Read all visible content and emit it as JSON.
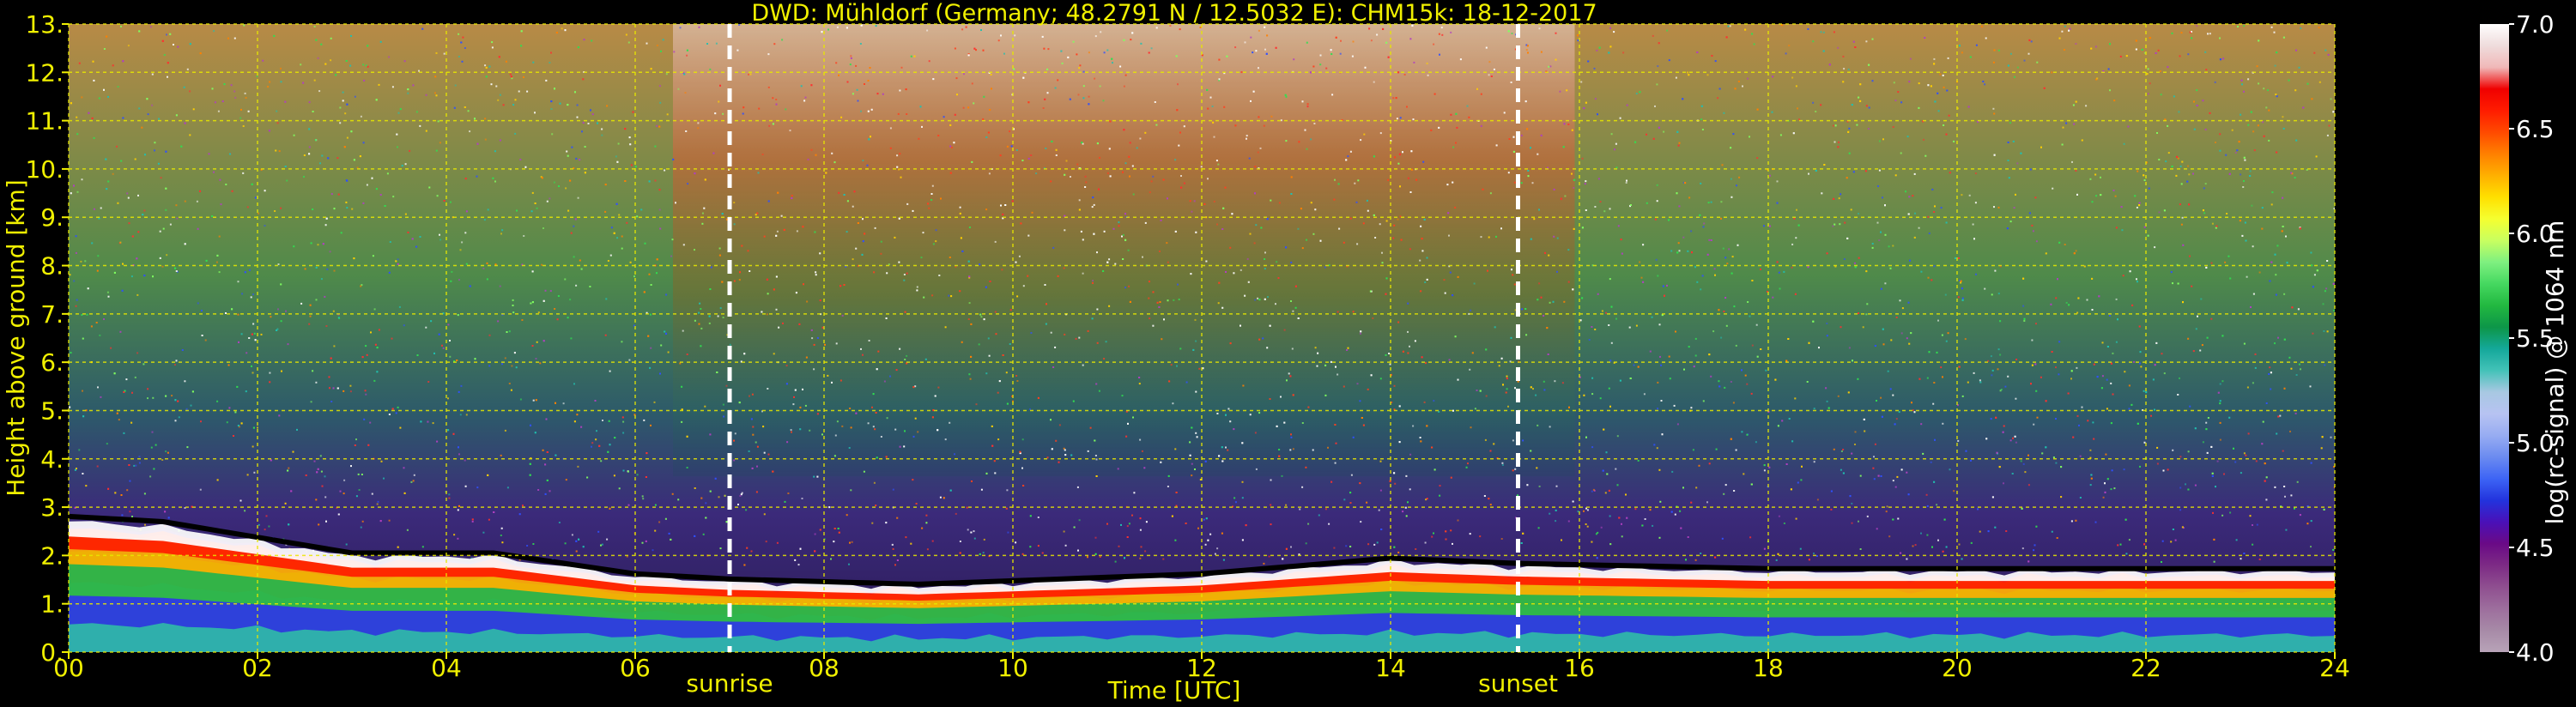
{
  "chart_data": {
    "type": "heatmap",
    "title": "DWD: Mühldorf (Germany; 48.2791 N / 12.5032 E):    CHM15k: 18-12-2017",
    "xlabel": "Time [UTC]",
    "ylabel": "Height above ground [km]",
    "xlim": [
      0,
      24
    ],
    "ylim": [
      0,
      13
    ],
    "x_ticks": [
      "00",
      "02",
      "04",
      "06",
      "08",
      "10",
      "12",
      "14",
      "16",
      "18",
      "20",
      "22",
      "24"
    ],
    "y_ticks": [
      "0.",
      "1.",
      "2.",
      "3.",
      "4.",
      "5.",
      "6.",
      "7.",
      "8.",
      "9.",
      "10.",
      "11.",
      "12.",
      "13."
    ],
    "grid": true,
    "markers": [
      {
        "label": "sunrise",
        "time_utc": 7.0
      },
      {
        "label": "sunset",
        "time_utc": 15.35
      }
    ],
    "boundary_layer_top_km": [
      {
        "time": 0.0,
        "height": 2.6
      },
      {
        "time": 1.0,
        "height": 2.5
      },
      {
        "time": 2.0,
        "height": 2.2
      },
      {
        "time": 3.0,
        "height": 1.9
      },
      {
        "time": 4.5,
        "height": 1.9
      },
      {
        "time": 6.0,
        "height": 1.5
      },
      {
        "time": 7.0,
        "height": 1.4
      },
      {
        "time": 9.0,
        "height": 1.3
      },
      {
        "time": 12.0,
        "height": 1.5
      },
      {
        "time": 14.0,
        "height": 1.8
      },
      {
        "time": 15.35,
        "height": 1.7
      },
      {
        "time": 18.0,
        "height": 1.6
      },
      {
        "time": 24.0,
        "height": 1.6
      }
    ],
    "colorbar": {
      "label": "log(rc-signal) @ 1064 nm",
      "min": 4.0,
      "max": 7.0,
      "ticks": [
        "4.0",
        "4.5",
        "5.0",
        "5.5",
        "6.0",
        "6.5",
        "7.0"
      ],
      "colors": [
        "#b8a3b8",
        "#a78aa7",
        "#9d6e9d",
        "#8f4f90",
        "#7d2b85",
        "#6a0a86",
        "#4a10b8",
        "#2233dd",
        "#3d64f5",
        "#6b8bf0",
        "#97acf2",
        "#b7c3f2",
        "#a8c8e2",
        "#43c2b8",
        "#14a89a",
        "#0d9648",
        "#22b840",
        "#45d860",
        "#7ef080",
        "#c8ff60",
        "#f5ff30",
        "#ffe000",
        "#ffb000",
        "#ff8000",
        "#ff4a00",
        "#ff1c00",
        "#f00000",
        "#f0b8b8",
        "#efdcdc",
        "#ffffff"
      ]
    }
  }
}
